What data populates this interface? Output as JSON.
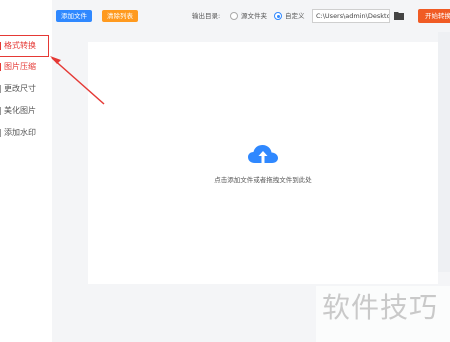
{
  "sidebar": {
    "items": [
      {
        "label": "格式转换",
        "active": true
      },
      {
        "label": "图片压缩",
        "active": true
      },
      {
        "label": "更改尺寸",
        "active": false
      },
      {
        "label": "美化图片",
        "active": false
      },
      {
        "label": "添加水印",
        "active": false
      }
    ]
  },
  "toolbar": {
    "add_files": "添加文件",
    "clear_list": "清除列表",
    "output_label": "输出目录:",
    "option_source": "源文件夹",
    "option_custom": "自定义",
    "selected_option": "自定义",
    "output_path": "C:\\Users\\admin\\Deskto",
    "start_button": "开始转换"
  },
  "main": {
    "drop_hint": "点击添加文件或者拖拽文件到此处"
  },
  "watermark": {
    "text": "软件技巧"
  },
  "colors": {
    "accent_blue": "#2f88ff",
    "accent_orange": "#ff9a1f",
    "start_red": "#f05b24",
    "highlight_red": "#e53935"
  }
}
